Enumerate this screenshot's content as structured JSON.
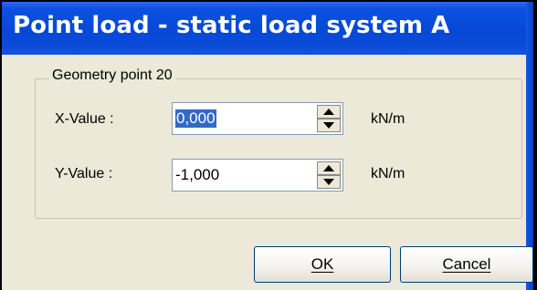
{
  "dialog": {
    "title": "Point load - static load system A"
  },
  "group": {
    "legend": "Geometry point 20"
  },
  "fields": {
    "x": {
      "label": "X-Value :",
      "value": "0,000",
      "unit": "kN/m"
    },
    "y": {
      "label": "Y-Value :",
      "value": "-1,000",
      "unit": "kN/m"
    }
  },
  "buttons": {
    "ok": "OK",
    "cancel": "Cancel"
  },
  "colors": {
    "title_bar": "#0a4bd8",
    "dialog_bg": "#ece9d8",
    "selection": "#316ac5"
  },
  "icons": [
    "spin-up-icon",
    "spin-down-icon"
  ]
}
